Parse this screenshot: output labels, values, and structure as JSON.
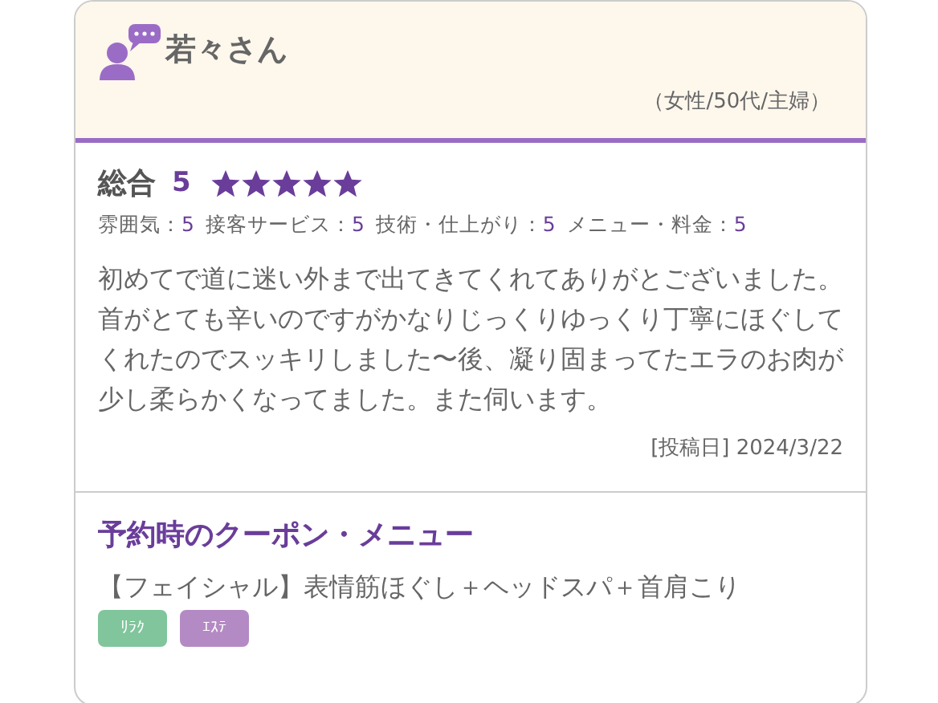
{
  "reviewer": {
    "name": "若々さん",
    "profile": "（女性/50代/主婦）"
  },
  "overall": {
    "label": "総合",
    "score": "5",
    "stars": 5
  },
  "ratings": [
    {
      "label": "雰囲気：",
      "value": "5"
    },
    {
      "label": "接客サービス：",
      "value": "5"
    },
    {
      "label": "技術・仕上がり：",
      "value": "5"
    },
    {
      "label": "メニュー・料金：",
      "value": "5"
    }
  ],
  "comment": "初めてで道に迷い外まで出てきてくれてありがとございました。首がとても辛いのですがかなりじっくりゆっくり丁寧にほぐしてくれたのでスッキリしました〜後、凝り固まってたエラのお肉が少し柔らかくなってました。また伺います。",
  "posted": "[投稿日] 2024/3/22",
  "coupon": {
    "title": "予約時のクーポン・メニュー",
    "menu": "【フェイシャル】表情筋ほぐし＋ヘッドスパ＋首肩こり",
    "tags": [
      {
        "label": "ﾘﾗｸ",
        "color": "#80c59c"
      },
      {
        "label": "ｴｽﾃ",
        "color": "#b48ac4"
      }
    ]
  }
}
